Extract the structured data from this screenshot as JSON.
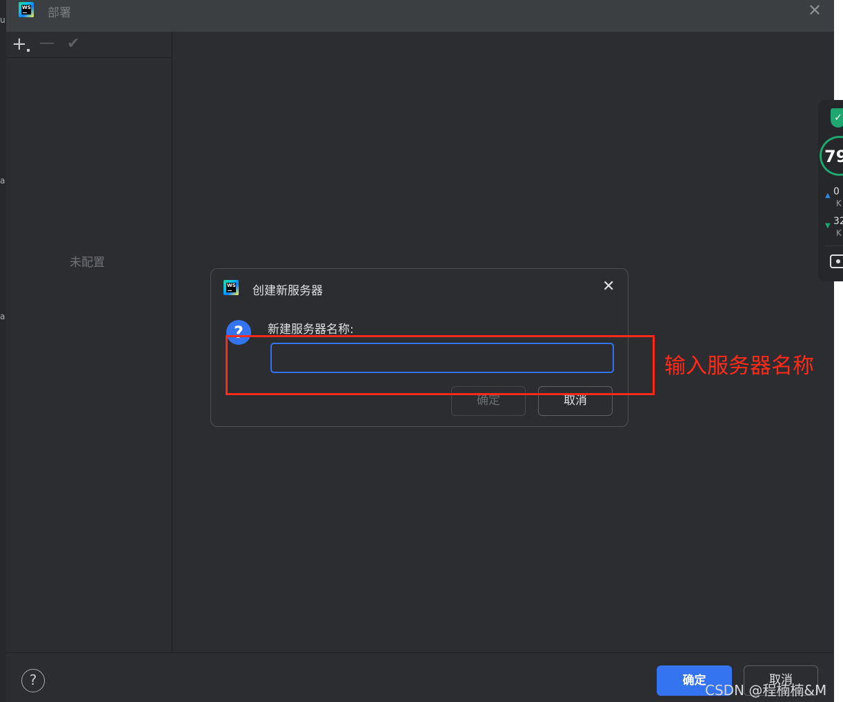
{
  "window": {
    "title": "部署",
    "close_glyph": "✕",
    "logo_text": "WS"
  },
  "toolbar": {
    "add_icon": "plus-icon",
    "remove_icon": "minus-icon",
    "apply_icon": "check-icon"
  },
  "left_panel": {
    "empty_text": "未配置"
  },
  "footer": {
    "help_glyph": "?",
    "ok_label": "确定",
    "cancel_label": "取消"
  },
  "dialog": {
    "title": "创建新服务器",
    "close_glyph": "✕",
    "question_glyph": "?",
    "prompt_label": "新建服务器名称:",
    "name_value": "",
    "ok_label": "确定",
    "cancel_label": "取消"
  },
  "annotation": {
    "text": "输入服务器名称",
    "color": "#ff2a1a"
  },
  "network_widget": {
    "score": "79",
    "upload_value": "0",
    "upload_unit": "K",
    "download_value": "32",
    "download_unit": "K"
  },
  "watermark": "CSDN @程楠楠&M",
  "colors": {
    "accent": "#3574f0",
    "background": "#2b2d30",
    "titlebar": "#3c3f41"
  }
}
